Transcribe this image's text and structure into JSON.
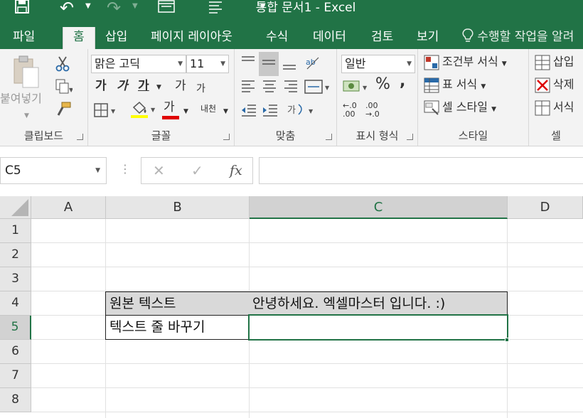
{
  "title": "통합 문서1 - Excel",
  "tabs": [
    {
      "label": "파일"
    },
    {
      "label": "홈",
      "active": true
    },
    {
      "label": "삽입"
    },
    {
      "label": "페이지 레이아웃"
    },
    {
      "label": "수식"
    },
    {
      "label": "데이터"
    },
    {
      "label": "검토"
    },
    {
      "label": "보기"
    }
  ],
  "tell_me": "수행할 작업을 알려",
  "ribbon": {
    "clipboard": {
      "paste": "붙여넣기",
      "label": "클립보드"
    },
    "font": {
      "name": "맑은 고딕",
      "size": "11",
      "bold": "가",
      "italic": "가",
      "underline": "가",
      "grow": "가",
      "shrink": "가",
      "font_color": "가",
      "phonetic": "내천",
      "label": "글꼴"
    },
    "alignment": {
      "label": "맞춤"
    },
    "number": {
      "format": "일반",
      "percent": "%",
      "comma": ",",
      "inc_decimal": "←.0\n.00",
      "dec_decimal": ".00\n→.0",
      "label": "표시 형식"
    },
    "styles": {
      "conditional": "조건부 서식",
      "table": "표 서식",
      "cell": "셀 스타일",
      "label": "스타일"
    },
    "cells": {
      "insert": "삽입",
      "delete": "삭제",
      "format": "서식",
      "label": "셀"
    }
  },
  "formula_bar": {
    "name_box": "C5",
    "fx": "fx",
    "cancel": "✕",
    "enter": "✓",
    "value": ""
  },
  "sheet": {
    "columns": [
      "A",
      "B",
      "C",
      "D"
    ],
    "rows": [
      "1",
      "2",
      "3",
      "4",
      "5",
      "6",
      "7",
      "8"
    ],
    "cells": {
      "B4": "원본 텍스트",
      "C4": "안녕하세요. 엑셀마스터 입니다. :)",
      "B5": "텍스트 줄 바꾸기",
      "C5": ""
    },
    "selected_cell": "C5"
  },
  "colors": {
    "accent": "#217346",
    "header_fill": "#d9d9d9"
  }
}
